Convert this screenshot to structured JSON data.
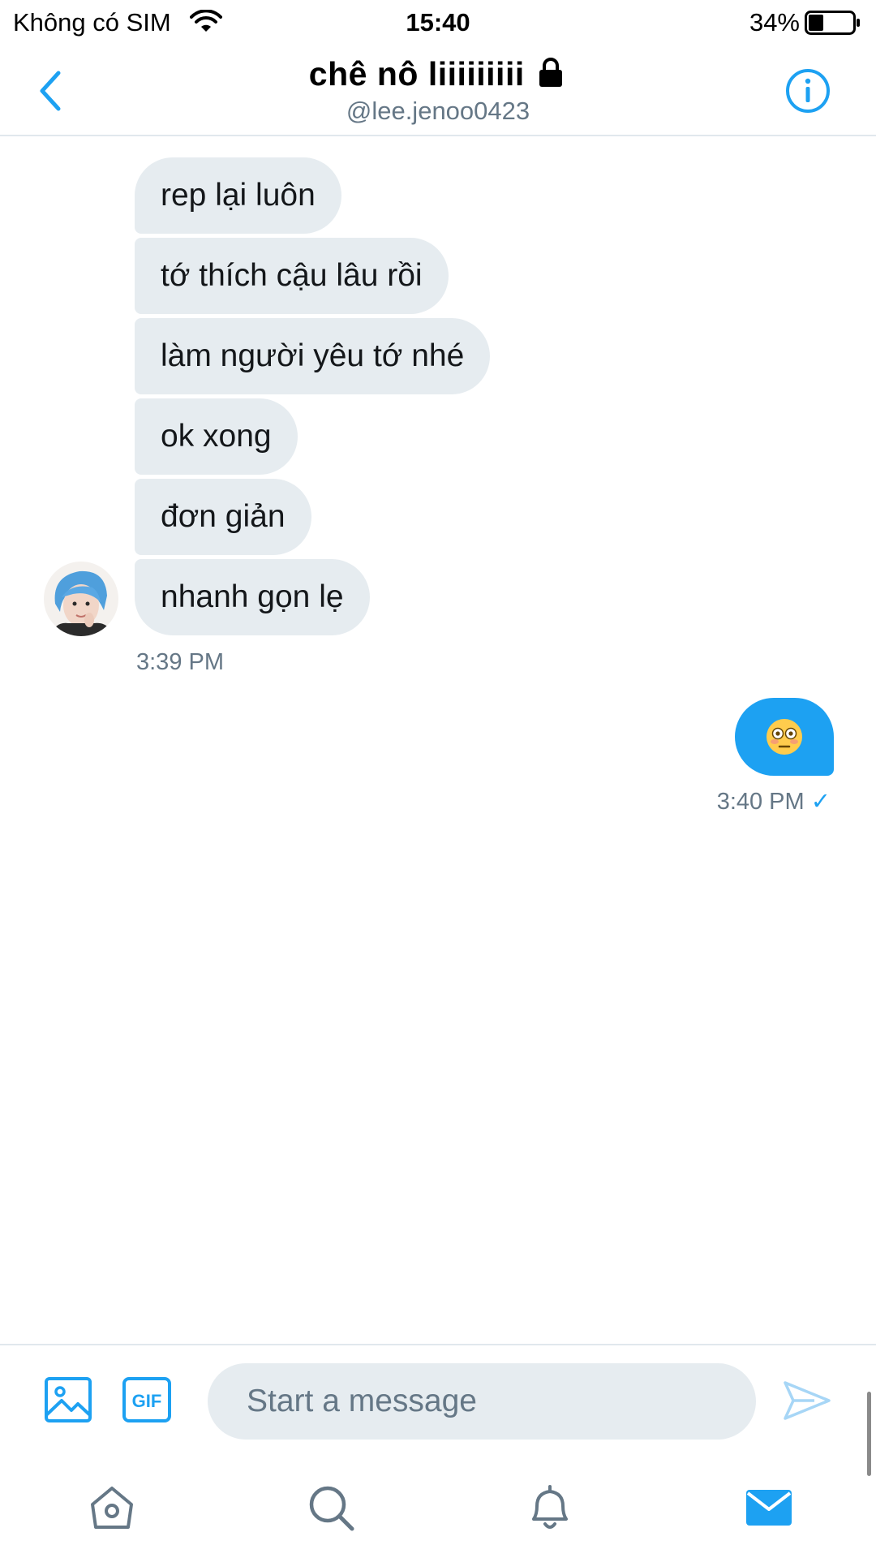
{
  "status_bar": {
    "carrier": "Không có SIM",
    "time": "15:40",
    "battery_percent": "34%",
    "battery_level": 0.34
  },
  "header": {
    "title": "chê nô liiiiiiiii",
    "handle": "@lee.jenoo0423",
    "back_icon": "chevron-left-icon",
    "lock_icon": "lock-icon",
    "info_icon": "info-icon"
  },
  "conversation": {
    "incoming": [
      {
        "text": "rep lại luôn"
      },
      {
        "text": "tớ thích cậu lâu rồi"
      },
      {
        "text": "làm người yêu tớ nhé"
      },
      {
        "text": "ok xong"
      },
      {
        "text": "đơn giản"
      },
      {
        "text": "nhanh gọn lẹ"
      }
    ],
    "incoming_time": "3:39 PM",
    "outgoing": [
      {
        "emoji": "flushed-face-emoji"
      }
    ],
    "outgoing_time": "3:40 PM",
    "read_mark": "✓"
  },
  "compose": {
    "placeholder": "Start a message",
    "value": "",
    "gif_label": "GIF"
  },
  "tabs": [
    {
      "name": "home-icon"
    },
    {
      "name": "search-icon"
    },
    {
      "name": "notifications-icon"
    },
    {
      "name": "messages-icon",
      "active": true
    }
  ],
  "colors": {
    "accent": "#1da1f2",
    "incoming_bubble": "#e6ecf0",
    "secondary_text": "#657786",
    "divider": "#e1e8ed"
  }
}
